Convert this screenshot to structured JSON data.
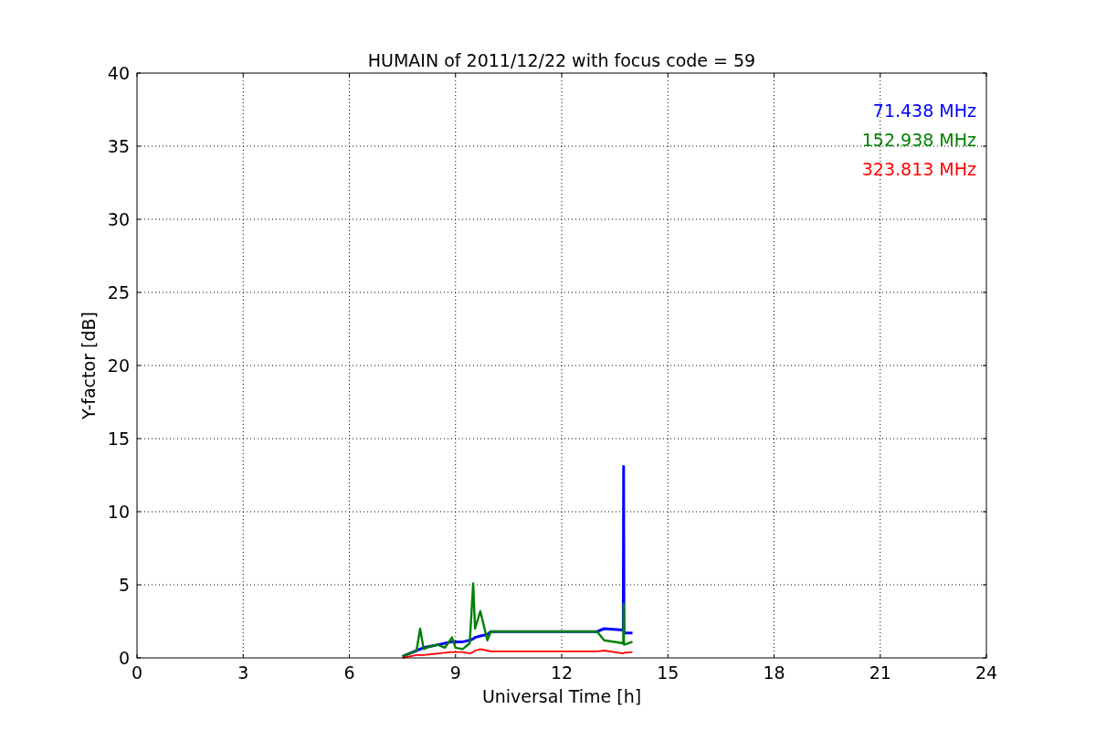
{
  "chart_data": {
    "type": "line",
    "title": "HUMAIN of 2011/12/22 with focus code = 59",
    "xlabel": "Universal Time [h]",
    "ylabel": "Y-factor [dB]",
    "xlim": [
      0,
      24
    ],
    "ylim": [
      0,
      40
    ],
    "xticks": [
      0,
      3,
      6,
      9,
      12,
      15,
      18,
      21,
      24
    ],
    "yticks": [
      0,
      5,
      10,
      15,
      20,
      25,
      30,
      35,
      40
    ],
    "grid": true,
    "x": [
      7.5,
      7.7,
      7.9,
      8.0,
      8.1,
      8.3,
      8.5,
      8.7,
      8.9,
      9.0,
      9.2,
      9.4,
      9.5,
      9.55,
      9.7,
      9.9,
      10.0,
      13.0,
      13.2,
      13.74,
      13.75,
      13.76,
      14.0
    ],
    "series": [
      {
        "name": "71.438 MHz",
        "color": "#0000ff",
        "values": [
          0.1,
          0.3,
          0.5,
          0.6,
          0.7,
          0.8,
          0.9,
          1.0,
          1.1,
          1.1,
          1.1,
          1.2,
          1.3,
          1.4,
          1.5,
          1.6,
          1.8,
          1.8,
          2.0,
          1.9,
          13.1,
          1.7,
          1.7
        ]
      },
      {
        "name": "152.938 MHz",
        "color": "#008000",
        "values": [
          0.1,
          0.3,
          0.5,
          2.0,
          0.6,
          0.8,
          0.9,
          0.7,
          1.4,
          0.7,
          0.6,
          1.0,
          5.1,
          2.0,
          3.2,
          1.2,
          1.8,
          1.8,
          1.2,
          1.0,
          3.7,
          0.9,
          1.1
        ]
      },
      {
        "name": "323.813 MHz",
        "color": "#ff0000",
        "values": [
          0.0,
          0.1,
          0.2,
          0.2,
          0.2,
          0.25,
          0.3,
          0.35,
          0.4,
          0.4,
          0.4,
          0.3,
          0.4,
          0.5,
          0.6,
          0.5,
          0.45,
          0.45,
          0.5,
          0.3,
          0.3,
          0.35,
          0.4
        ]
      }
    ]
  }
}
